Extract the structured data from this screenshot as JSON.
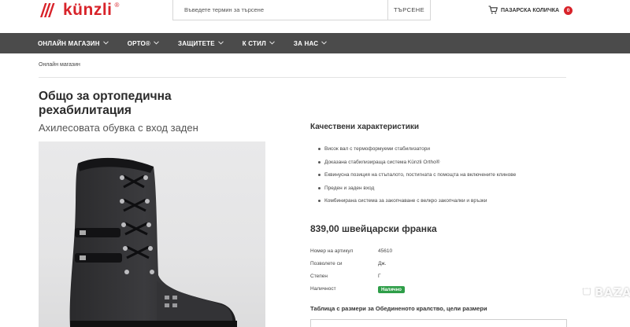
{
  "brand": {
    "name": "künzli",
    "reg": "®",
    "accent": "#d8232a"
  },
  "search": {
    "placeholder": "Въведете термин за търсене",
    "button_label": "ТЪРСЕНЕ"
  },
  "cart": {
    "label": "ПАЗАРСКА КОЛИЧКА",
    "count": "0",
    "icon": "cart-icon"
  },
  "nav": {
    "items": [
      {
        "label": "ОНЛАЙН МАГАЗИН",
        "has_dropdown": true
      },
      {
        "label": "ОРТО®",
        "has_dropdown": true
      },
      {
        "label": "ЗАЩИТЕТЕ",
        "has_dropdown": true
      },
      {
        "label": "К СТИЛ",
        "has_dropdown": true
      },
      {
        "label": "ЗА НАС",
        "has_dropdown": true
      }
    ],
    "dropdown_icon": "chevron-down-icon"
  },
  "breadcrumb": "Онлайн магазин",
  "product": {
    "title": "Общо за ортопедична рехабилитация",
    "subtitle": "Ахилесовата обувка с вход заден",
    "image": "black-orthopedic-boot"
  },
  "features": {
    "heading": "Качествени характеристики",
    "items": [
      "Висок вал с термоформуеми стабилизатори",
      "Доказана стабилизираща система Künzli Ortho®",
      "Еквинусна позиция на стъпалото, постигната с помощта на включените клинове",
      "Преден и заден вход",
      "Комбинирана система за закопчаване с велкро закопчалки и връзки"
    ]
  },
  "price": "839,00 швейцарски франка",
  "specs": {
    "article_label": "Номер на артикул",
    "article_value": "45610",
    "allow_label": "Позволете си",
    "allow_value": "Дж.",
    "degree_label": "Степен",
    "degree_value": "Г",
    "availability_label": "Наличност",
    "availability_value": "Налично",
    "availability_color": "#2e9e48"
  },
  "size_table": {
    "title": "Таблица с размери за Обединеното кралство, цели размери"
  },
  "watermark": {
    "text": "BAZAR"
  }
}
